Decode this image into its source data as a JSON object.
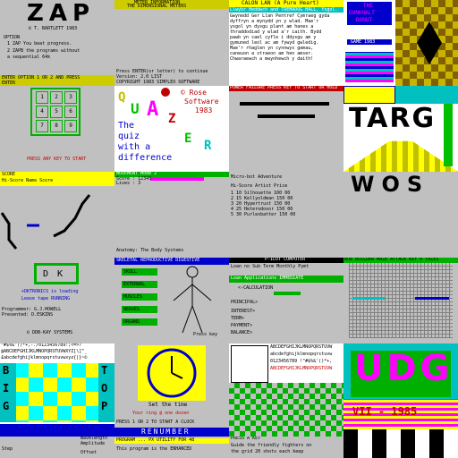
{
  "grid_title": "",
  "tiles": {
    "zap": {
      "title": "ZAP",
      "author": "© T. BARTLETT 1983",
      "option_label": "OPTION",
      "opt1": "1  ZAP   You beat progress.",
      "opt2": "2  ZAPB  the programs without",
      "opt3": "          a sequential 64k",
      "footer": "ENTER OPTION 1 OR 2 AND PRESS",
      "footer2": "ENTER"
    },
    "meter": {
      "title": "METER INFORMATION",
      "subtitle": "THE DIMENSIONAL METERS",
      "line1": "Press ENTER(or letter) to continue",
      "line2": "Version: 2.0 LIST",
      "line3": "COPYRIGHT 1983 SIMPLEX SOFTWARE"
    },
    "calon": {
      "title": "CALON LAN (A Pure Heart)",
      "sub": "Llwybr Heddwch and TREMADOG HALL, Ysgol.",
      "body": [
        "Gwynedd Ger Llan Pentref Cymraeg gyda",
        "dyffryn a mynydd yn y wlad. Mae'r",
        "ysgol yn dysgu plant am hanes a",
        "thraddodiad y wlad a'r iaith. Bydd",
        "pawb yn cael cyfle i ddysgu am y",
        "gymuned leol ac am fywyd gwledig.",
        "Mae'r rhaglen yn cynnwys gemau,",
        "caneuon a straeon am hen amser.",
        "Chwaraewch a mwynhewch y daith!"
      ]
    },
    "dunkhalt": {
      "label1": "THE",
      "label2": "DUNKHALT",
      "label3": "DONUT",
      "label4": "GAME 1983"
    },
    "grid9": {
      "cells": [
        "1",
        "2",
        "3",
        "4",
        "5",
        "6",
        "7",
        "8",
        "9"
      ],
      "caption": "PRESS ANY KEY TO START"
    },
    "quazer": {
      "copyright": "© Rose",
      "company": "Software",
      "year": "1983",
      "letters": [
        "Q",
        "U",
        "A",
        "Z",
        "E",
        "R"
      ],
      "tagline1": "The",
      "tagline2": "quiz",
      "tagline3": "with a",
      "tagline4": "difference"
    },
    "bars": {
      "header": "POWER FAILURE PRESS KEY TO START OR HOLD"
    },
    "targ": {
      "title": "TARG"
    },
    "hiscore": {
      "header": "SCORE",
      "cols": "Hi-Score  Name  Score"
    },
    "menu": {
      "bar": "MOVEMENT          Mode 2",
      "line1": "Score :    12345",
      "line2": "Lives :    3"
    },
    "table": {
      "title": "Micro-bot Adventure",
      "cols": "Hi-Score Artist     Price",
      "rows": [
        "1  10  Silhouette    100 00",
        "2  15  Kellyoldman   150 00",
        "3  20  Hypertrust    150 00",
        "4  25  Heterodoxor   150 00",
        "5  30  Purlexbatter  150 00"
      ]
    },
    "wos": {
      "title": "WOS"
    },
    "dk": {
      "letters": "DK",
      "msg": "+DKTRONICS is loading",
      "sub": "Leave tape   RUNNING",
      "credit1": "Programmer:  G.J.HOWELL",
      "credit2": "Presented:   D.ESKINS",
      "footer": "© DDB-KAY SYSTEMS"
    },
    "anatomy": {
      "top": "Anatomy: The Body Systems",
      "bar": "SKELETAL  REPRODUCTIVE  DIGESTIVE",
      "buttons": [
        "SKULL",
        "EXTERNAL",
        "MUSCLES",
        "NERVES",
        "ORGANS"
      ],
      "foot": "Press key"
    },
    "form": {
      "header": "P-ILOT COMPUTER",
      "l1": "Loan no  Sub Term Monthly Pymt",
      "l2": "Loan Applications   IMMEDIATE",
      "l3": "<-CALCULATION",
      "f1": "PRINCIPAL>",
      "f2": "INTEREST>",
      "f3": "TERM>",
      "f4": "PAYMENT>",
      "f5": "BALANCE>"
    },
    "maze": {
      "bar": "BOB BUILDER MAZE  ATTACK KEY 0 TRIES"
    },
    "charset": {
      "line1": " \"#$%&'()*+,-./0123456789:;<=>?",
      "line2": "@ABCDEFGHIJKLMNOPQRSTUVWXYZ[\\]^_",
      "line3": "£abcdefghijklmnopqrstuvwxyz{|}~©",
      "big": [
        "B",
        "I",
        "G"
      ],
      "top": [
        "T",
        "O",
        "P"
      ]
    },
    "clock": {
      "caption": "Set the time",
      "line": "Your ring  @ one dozen",
      "keys": "PRESS 1 OR 2 TO START A CLOCK"
    },
    "udg": {
      "big": "UDG",
      "sub": "VII - 1985"
    },
    "renumber": {
      "title": "RENUMBER",
      "sub": "PROGRAM ...  PX UTILITY FOR 48",
      "line": "This program is the ENHANCED"
    },
    "fighters": {
      "header": "PRESS A KEY",
      "line1": "Guide the friendly fighters on",
      "line2": "the grid 20 shots each keep"
    },
    "graph": {
      "l1": "Wavelength",
      "l2": "Amplitude",
      "l3": "Step",
      "l4": "Offset"
    },
    "chars2": {
      "line1": "ABCDEFGHIJKLMNOPQRSTUVW",
      "line2": "abcdefghijklmnopqrstuvw",
      "line3": "0123456789 !\"#$%&'()*+,",
      "line4": "ABCDEFGHIJKLMNOPQRSTUVW"
    }
  }
}
